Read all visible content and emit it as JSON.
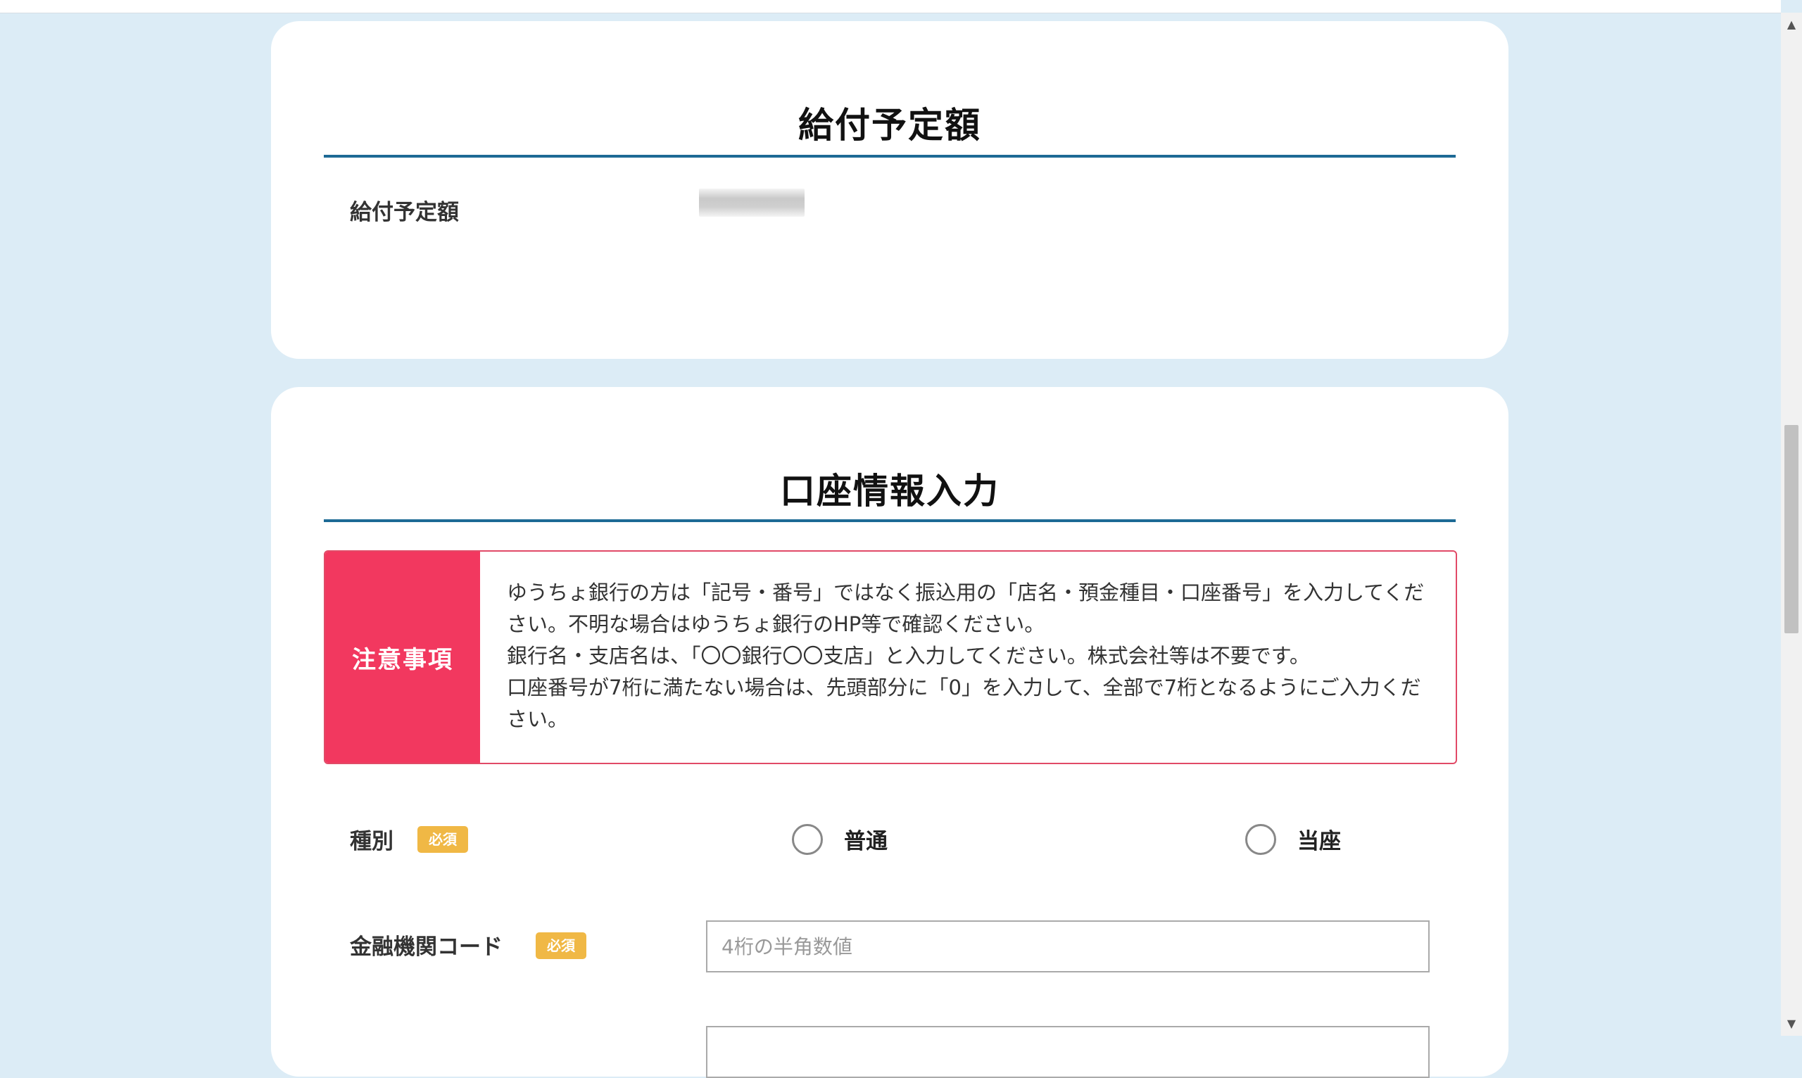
{
  "amount_section": {
    "title": "給付予定額",
    "label": "給付予定額",
    "value": "●●●●●"
  },
  "account_section": {
    "title": "口座情報入力",
    "notice": {
      "heading": "注意事項",
      "lines": [
        "ゆうちょ銀行の方は「記号・番号」ではなく振込用の「店名・預金種目・口座番号」を入力してください。不明な場合はゆうちょ銀行のHP等で確認ください。",
        "銀行名・支店名は、「〇〇銀行〇〇支店」と入力してください。株式会社等は不要です。",
        "口座番号が7桁に満たない場合は、先頭部分に「0」を入力して、全部で7桁となるようにご入力ください。"
      ]
    },
    "kind": {
      "label": "種別",
      "required": "必須",
      "options": [
        "普通",
        "当座"
      ]
    },
    "institution_code": {
      "label": "金融機関コード",
      "required": "必須",
      "value": "",
      "placeholder": "4桁の半角数値"
    }
  },
  "icons": {
    "scroll_up": "triangle-up-icon",
    "scroll_down": "triangle-down-icon",
    "radio": "radio-empty-icon"
  },
  "colors": {
    "page_bg": "#dcecf6",
    "title_underline": "#1d6a95",
    "notice_accent": "#f2385f",
    "required_badge": "#f0b845"
  }
}
